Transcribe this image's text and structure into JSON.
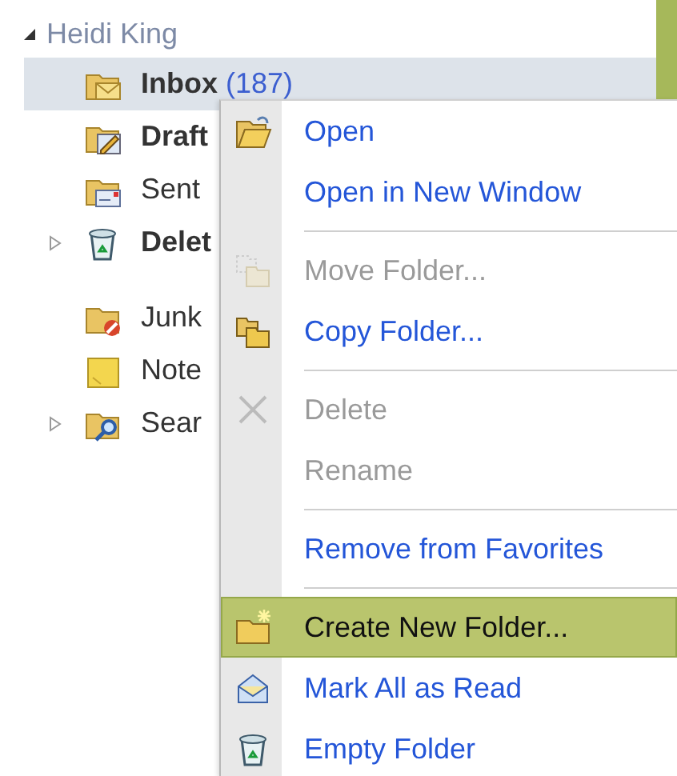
{
  "account": {
    "label": "Heidi King",
    "expanded": true,
    "sections": [
      {
        "children": [
          {
            "kind": "inbox",
            "label": "Inbox",
            "count": "(187)",
            "unread": true,
            "selected": true
          },
          {
            "kind": "drafts",
            "label": "Draft",
            "unread": true,
            "selected": false
          },
          {
            "kind": "sent",
            "label": "Sent",
            "unread": false,
            "selected": false
          },
          {
            "kind": "deleted",
            "label": "Delet",
            "unread": true,
            "selected": false,
            "expanded": false
          }
        ]
      },
      {
        "children": [
          {
            "kind": "junk",
            "label": "Junk",
            "unread": false,
            "selected": false
          },
          {
            "kind": "notes",
            "label": "Note",
            "unread": false,
            "selected": false
          },
          {
            "kind": "search",
            "label": "Sear",
            "unread": false,
            "selected": false,
            "expanded": false
          }
        ]
      }
    ]
  },
  "context_menu": {
    "groups": [
      [
        {
          "kind": "open",
          "label": "Open",
          "disabled": false,
          "selected": false
        },
        {
          "kind": "plain",
          "label": "Open in New Window",
          "disabled": false,
          "selected": false
        }
      ],
      [
        {
          "kind": "move",
          "label": "Move Folder...",
          "disabled": true,
          "selected": false
        },
        {
          "kind": "copy",
          "label": "Copy Folder...",
          "disabled": false,
          "selected": false
        }
      ],
      [
        {
          "kind": "delete",
          "label": "Delete",
          "disabled": true,
          "selected": false
        },
        {
          "kind": "plain",
          "label": "Rename",
          "disabled": true,
          "selected": false
        }
      ],
      [
        {
          "kind": "plain",
          "label": "Remove from Favorites",
          "disabled": false,
          "selected": false
        }
      ],
      [
        {
          "kind": "create",
          "label": "Create New Folder...",
          "disabled": false,
          "selected": true
        },
        {
          "kind": "markread",
          "label": "Mark All as Read",
          "disabled": false,
          "selected": false
        },
        {
          "kind": "empty",
          "label": "Empty Folder",
          "disabled": false,
          "selected": false
        }
      ]
    ]
  }
}
